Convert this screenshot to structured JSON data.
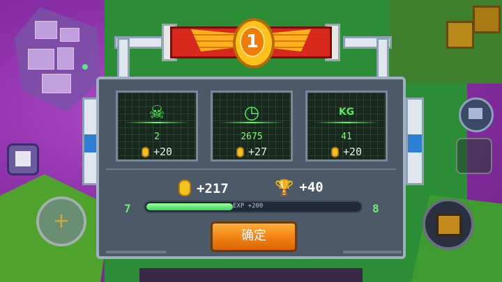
{
  "rank": "1",
  "stats": [
    {
      "icon": "☠",
      "value": "2",
      "reward": "+20"
    },
    {
      "icon": "◷",
      "value": "2675",
      "reward": "+27"
    },
    {
      "icon": "KG",
      "value": "41",
      "reward": "+20"
    }
  ],
  "totals": {
    "coins": "+217",
    "trophies": "+40"
  },
  "level": {
    "current": "7",
    "next": "8",
    "exp_text": "EXP +200",
    "progress": 0.4
  },
  "confirm_label": "确定",
  "colors": {
    "accent_green": "#4ff05a",
    "button_orange": "#f07d10",
    "banner_red": "#d8281e",
    "coin_gold": "#f6c21c"
  }
}
